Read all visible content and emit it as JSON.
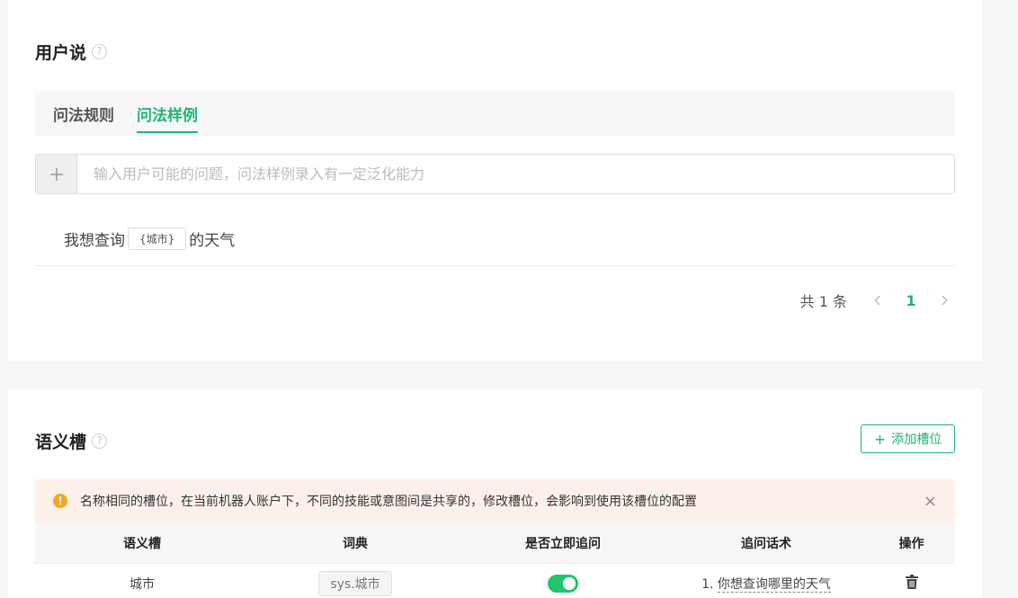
{
  "utterance_section": {
    "title": "用户说",
    "help": "?",
    "tabs": [
      {
        "label": "问法规则",
        "active": false
      },
      {
        "label": "问法样例",
        "active": true
      }
    ],
    "input_placeholder": "输入用户可能的问题，问法样例录入有一定泛化能力",
    "example": {
      "prefix": "我想查询",
      "slot": "{城市}",
      "suffix": "的天气"
    },
    "pagination": {
      "total_text": "共 1 条",
      "prev": "‹",
      "current_page": "1",
      "next": "›"
    }
  },
  "slot_section": {
    "title": "语义槽",
    "help": "?",
    "add_button": "添加槽位",
    "add_icon": "+",
    "alert": {
      "icon": "!",
      "text": "名称相同的槽位，在当前机器人账户下，不同的技能或意图间是共享的，修改槽位，会影响到使用该槽位的配置",
      "close": "×"
    },
    "table": {
      "headers": [
        "语义槽",
        "词典",
        "是否立即追问",
        "追问话术",
        "操作"
      ],
      "rows": [
        {
          "slot": "城市",
          "dict": "sys.城市",
          "ask_immediately": true,
          "followup_index": "1.",
          "followup": "你想查询哪里的天气"
        }
      ]
    }
  },
  "colors": {
    "accent": "#1fb573",
    "toggle_on": "#1fc66e",
    "alert_bg": "#fdf0eb",
    "warn": "#f5a623"
  }
}
